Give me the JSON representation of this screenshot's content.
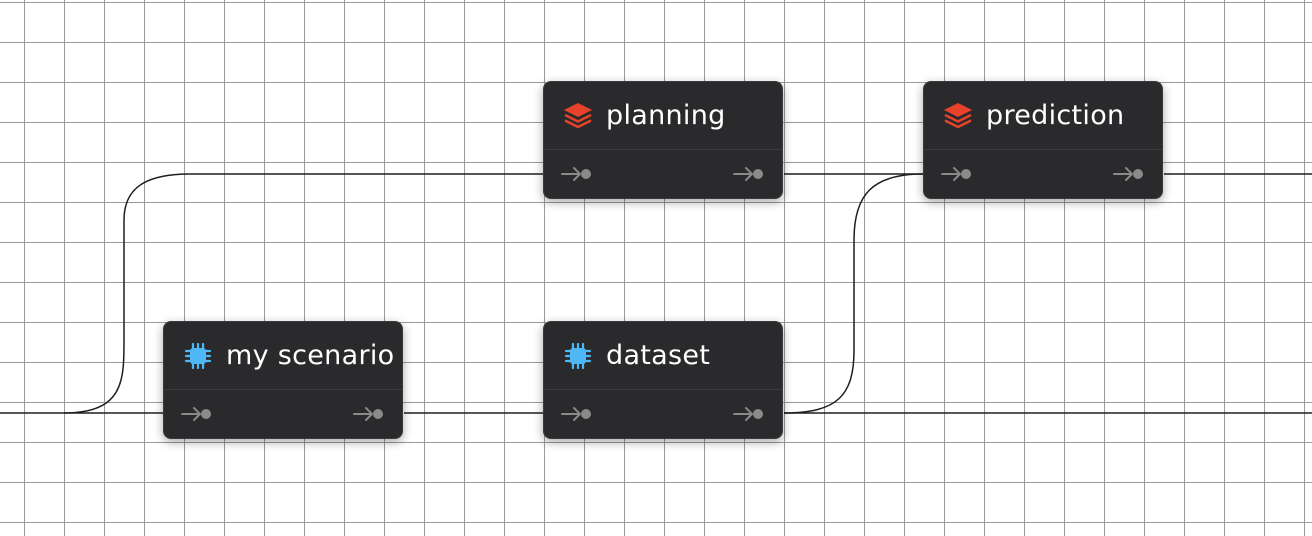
{
  "canvas": {
    "grid": true,
    "colors": {
      "grid_line": "#9a9a9a",
      "background": "#ffffff",
      "wire": "#1e1e1e",
      "node_bg": "#2a2a2c",
      "port": "#8a8a8a",
      "stack_icon": "#e8432a",
      "chip_icon": "#4db8f5"
    }
  },
  "nodes": [
    {
      "id": "my_scenario",
      "title": "my scenario",
      "icon": "chip-icon"
    },
    {
      "id": "dataset",
      "title": "dataset",
      "icon": "chip-icon"
    },
    {
      "id": "planning",
      "title": "planning",
      "icon": "layers-icon"
    },
    {
      "id": "prediction",
      "title": "prediction",
      "icon": "layers-icon"
    }
  ],
  "connections": [
    {
      "from": "input",
      "to": "my_scenario"
    },
    {
      "from": "input",
      "to": "planning"
    },
    {
      "from": "my_scenario",
      "to": "dataset"
    },
    {
      "from": "planning",
      "to": "prediction"
    },
    {
      "from": "dataset",
      "to": "prediction"
    },
    {
      "from": "dataset",
      "to": "output"
    },
    {
      "from": "prediction",
      "to": "output"
    }
  ]
}
